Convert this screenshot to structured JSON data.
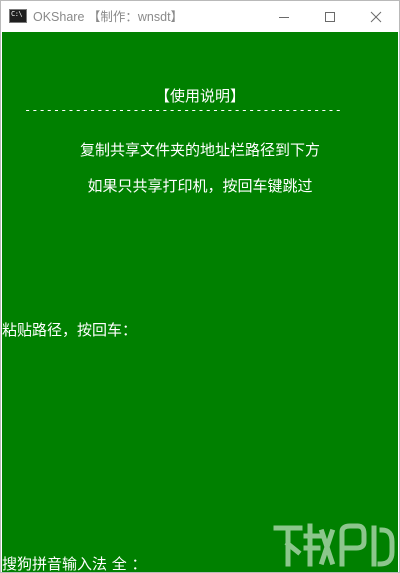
{
  "window": {
    "title": "OKShare 【制作：wnsdt】",
    "icon_label": "C:\\"
  },
  "console": {
    "heading": "【使用说明】",
    "divider": "--------------------------------------------",
    "copy_instruction": "复制共享文件夹的地址栏路径到下方",
    "printer_instruction": "如果只共享打印机，按回车键跳过",
    "prompt": "粘贴路径，按回车：",
    "ime_status": "搜狗拼音输入法 全 ："
  },
  "colors": {
    "console_bg": "#008000",
    "console_text": "#ffffff",
    "titlebar_bg": "#ffffff",
    "title_text": "#8a8a8a"
  },
  "icons": {
    "app": "console-icon",
    "minimize": "minimize-icon",
    "maximize": "maximize-icon",
    "close": "close-icon",
    "watermark": "download-site-logo"
  }
}
